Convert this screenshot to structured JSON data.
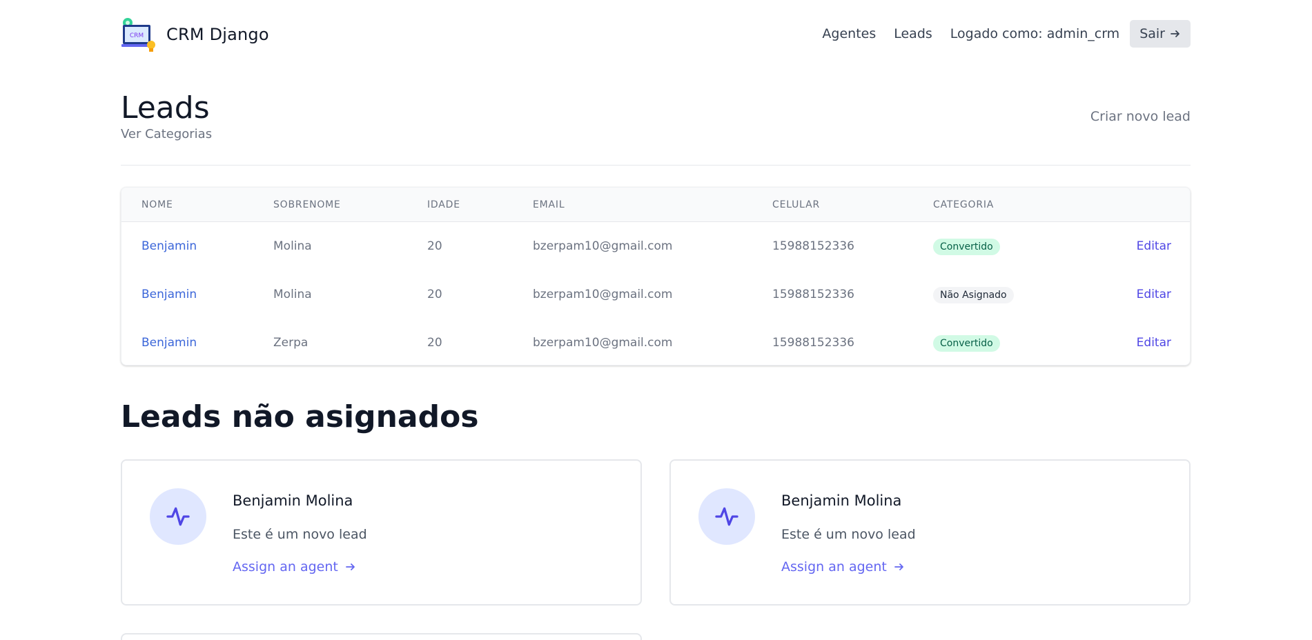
{
  "header": {
    "brand": "CRM Django",
    "logo_text": "CRM",
    "nav": {
      "agents": "Agentes",
      "leads": "Leads",
      "user": "Logado como: admin_crm",
      "logout": "Sair"
    }
  },
  "page": {
    "title": "Leads",
    "categories_link": "Ver Categorias",
    "new_lead": "Criar novo lead"
  },
  "table": {
    "headers": [
      "Nome",
      "Sobrenome",
      "Idade",
      "Email",
      "Celular",
      "Categoria"
    ],
    "rows": [
      {
        "name": "Benjamin",
        "surname": "Molina",
        "age": "20",
        "email": "bzerpam10@gmail.com",
        "phone": "15988152336",
        "category": "Convertido",
        "category_style": "green",
        "action": "Editar"
      },
      {
        "name": "Benjamin",
        "surname": "Molina",
        "age": "20",
        "email": "bzerpam10@gmail.com",
        "phone": "15988152336",
        "category": "Não Asignado",
        "category_style": "gray",
        "action": "Editar"
      },
      {
        "name": "Benjamin",
        "surname": "Zerpa",
        "age": "20",
        "email": "bzerpam10@gmail.com",
        "phone": "15988152336",
        "category": "Convertido",
        "category_style": "green",
        "action": "Editar"
      }
    ]
  },
  "unassigned": {
    "title": "Leads não asignados",
    "cards": [
      {
        "name": "Benjamin Molina",
        "description": "Este é um novo lead",
        "link": "Assign an agent",
        "icon": "activity-icon"
      },
      {
        "name": "Benjamin Molina",
        "description": "Este é um novo lead",
        "link": "Assign an agent",
        "icon": "activity-icon"
      }
    ]
  },
  "colors": {
    "link_blue": "#3b66d9",
    "accent_indigo": "#6366f1",
    "badge_green_bg": "#d1fae5",
    "badge_green_text": "#065f46"
  }
}
